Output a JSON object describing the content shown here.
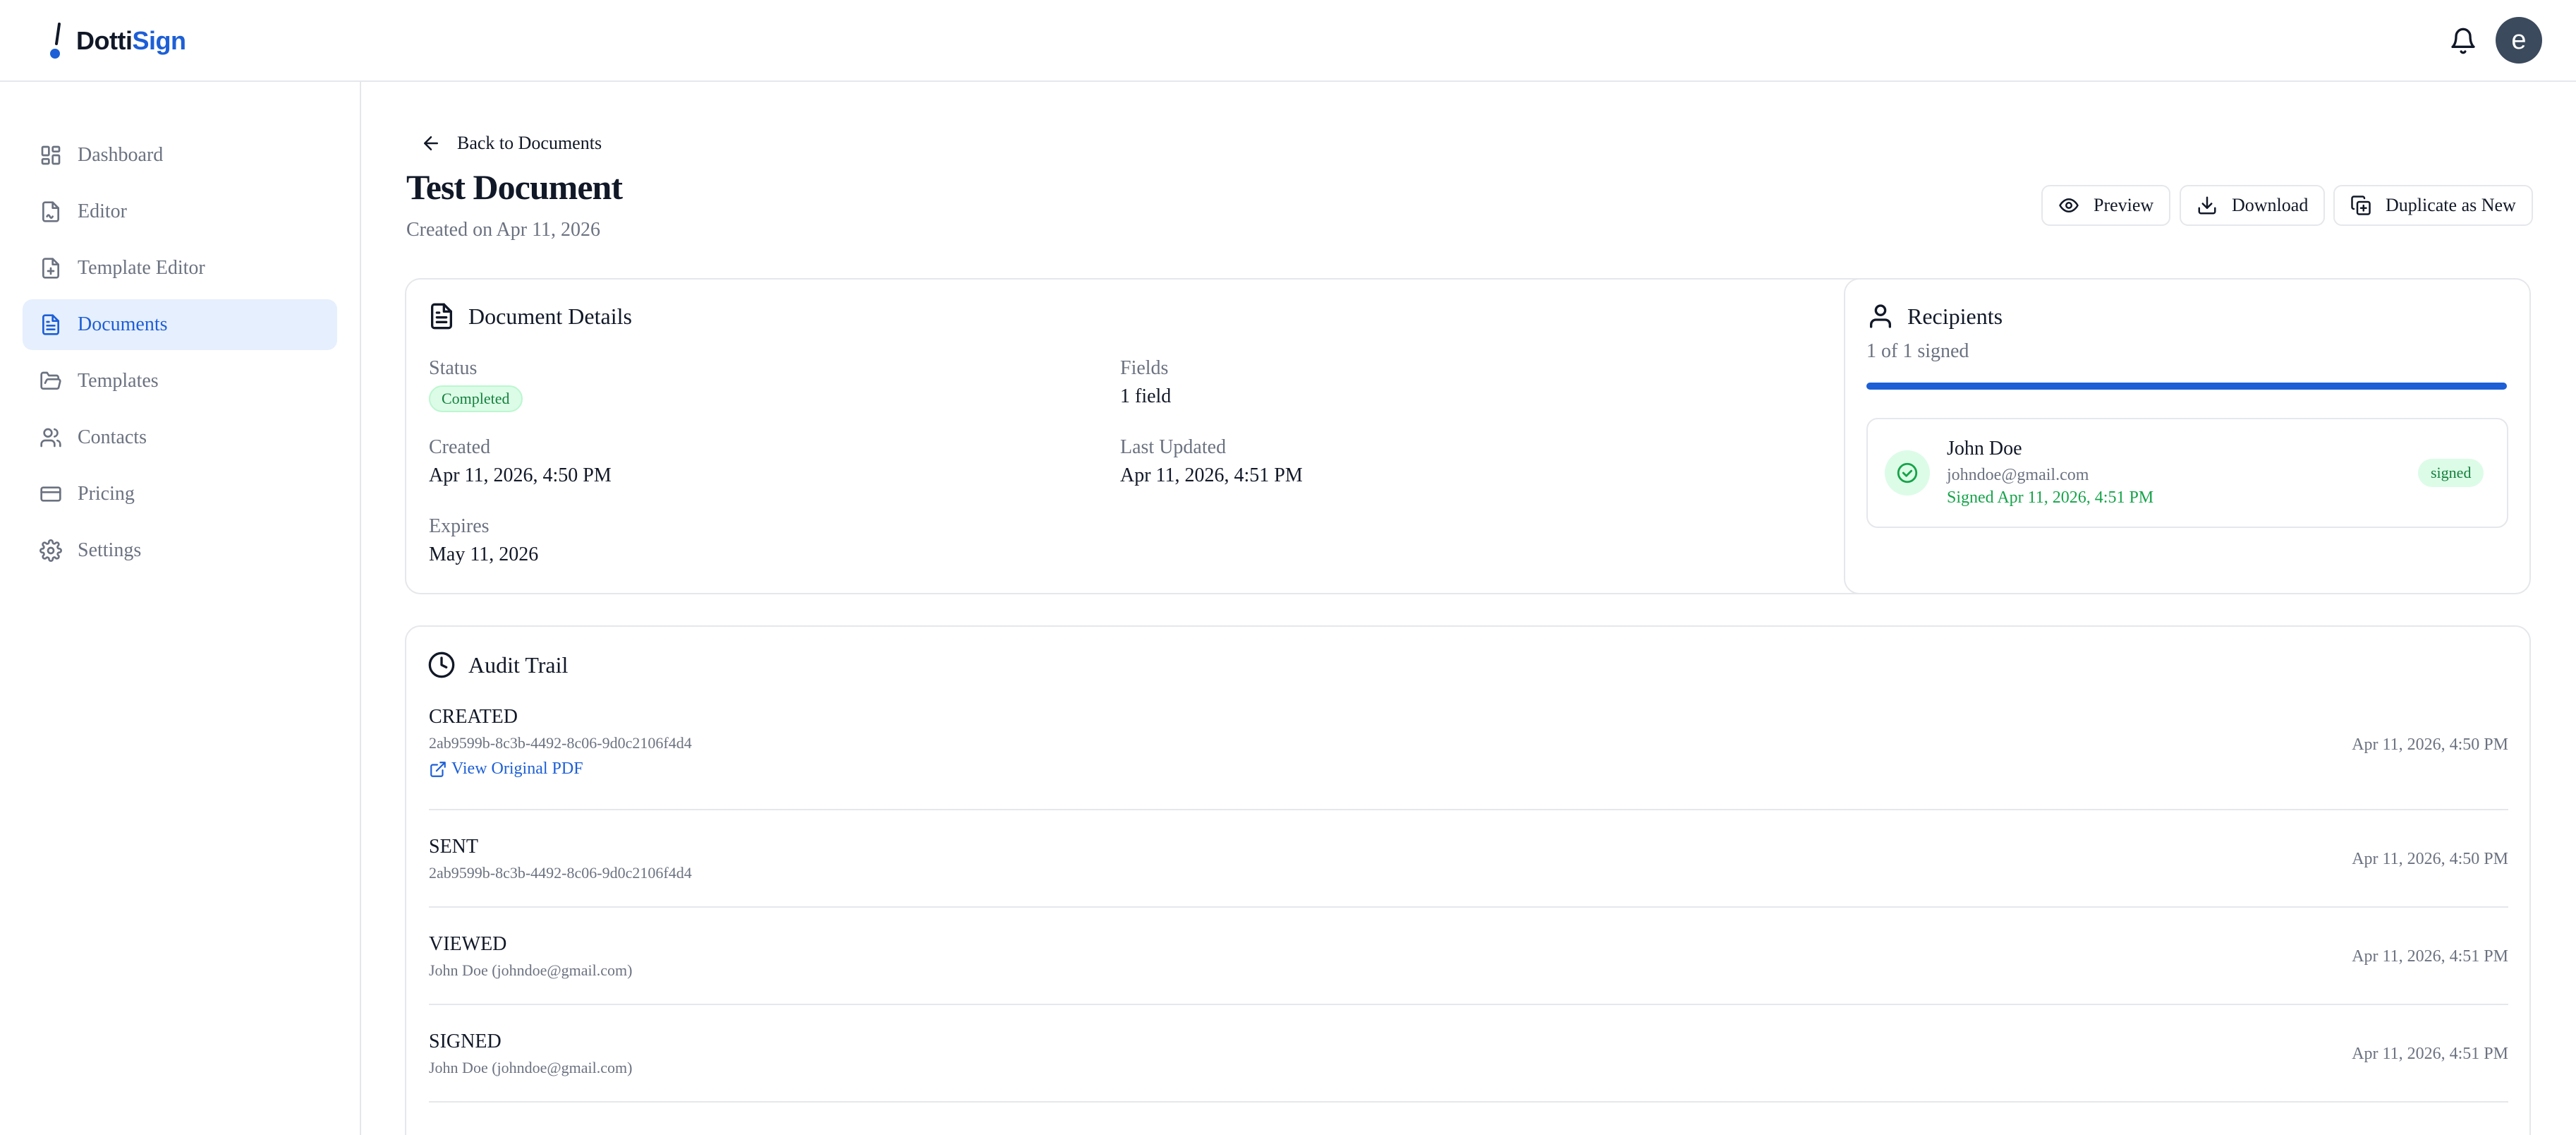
{
  "app": {
    "name_part1": "Dotti",
    "name_part2": "Sign",
    "avatar_initial": "e"
  },
  "sidebar": {
    "items": [
      {
        "label": "Dashboard",
        "icon": "dashboard-icon"
      },
      {
        "label": "Editor",
        "icon": "file-signature-icon"
      },
      {
        "label": "Template Editor",
        "icon": "file-plus-icon"
      },
      {
        "label": "Documents",
        "icon": "file-text-icon",
        "active": true
      },
      {
        "label": "Templates",
        "icon": "folder-open-icon"
      },
      {
        "label": "Contacts",
        "icon": "users-icon"
      },
      {
        "label": "Pricing",
        "icon": "credit-card-icon"
      },
      {
        "label": "Settings",
        "icon": "gear-icon"
      }
    ]
  },
  "header": {
    "back_label": "Back to Documents",
    "title": "Test Document",
    "subtitle": "Created on Apr 11, 2026",
    "actions": {
      "preview": "Preview",
      "download": "Download",
      "duplicate": "Duplicate as New"
    }
  },
  "details": {
    "title": "Document Details",
    "status_label": "Status",
    "status_value": "Completed",
    "fields_label": "Fields",
    "fields_value": "1 field",
    "created_label": "Created",
    "created_value": "Apr 11, 2026, 4:50 PM",
    "updated_label": "Last Updated",
    "updated_value": "Apr 11, 2026, 4:51 PM",
    "expires_label": "Expires",
    "expires_value": "May 11, 2026"
  },
  "recipients": {
    "title": "Recipients",
    "summary": "1 of 1 signed",
    "progress_fraction": 1.0,
    "list": [
      {
        "name": "John Doe",
        "email": "johndoe@gmail.com",
        "signed_text": "Signed Apr 11, 2026, 4:51 PM",
        "badge": "signed"
      }
    ]
  },
  "audit": {
    "title": "Audit Trail",
    "events": [
      {
        "event": "CREATED",
        "detail": "2ab9599b-8c3b-4492-8c06-9d0c2106f4d4",
        "time": "Apr 11, 2026, 4:50 PM",
        "link": "View Original PDF"
      },
      {
        "event": "SENT",
        "detail": "2ab9599b-8c3b-4492-8c06-9d0c2106f4d4",
        "time": "Apr 11, 2026, 4:50 PM"
      },
      {
        "event": "VIEWED",
        "detail": "John Doe (johndoe@gmail.com)",
        "time": "Apr 11, 2026, 4:51 PM"
      },
      {
        "event": "SIGNED",
        "detail": "John Doe (johndoe@gmail.com)",
        "time": "Apr 11, 2026, 4:51 PM"
      }
    ]
  },
  "colors": {
    "accent": "#1d5fd6",
    "success": "#16a34a",
    "success_bg": "#dcfce7",
    "border": "#e5e7eb",
    "muted": "#6b7280"
  }
}
